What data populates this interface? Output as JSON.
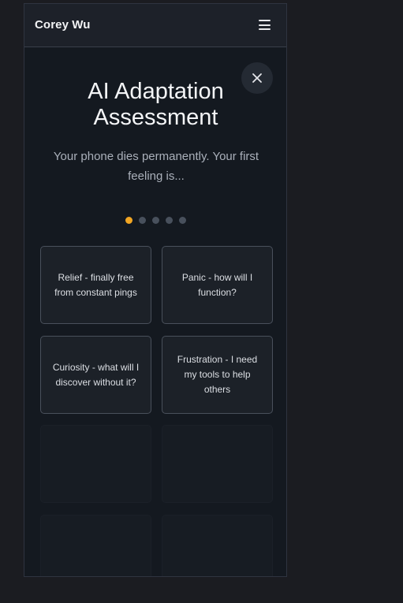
{
  "header": {
    "brand": "Corey Wu",
    "menu_icon": "hamburger-menu-icon"
  },
  "modal": {
    "close_icon": "close-icon",
    "title_line1": "AI Adaptation",
    "title_line2": "Assessment",
    "question": "Your phone dies permanently. Your first feeling is..."
  },
  "progress": {
    "current_step": 1,
    "total_steps": 5,
    "active_color": "#f2a623",
    "inactive_color": "#48505c"
  },
  "options": [
    {
      "label": "Relief - finally free from constant pings"
    },
    {
      "label": "Panic - how will I function?"
    },
    {
      "label": "Curiosity - what will I discover without it?"
    },
    {
      "label": "Frustration - I need my tools to help others"
    }
  ]
}
